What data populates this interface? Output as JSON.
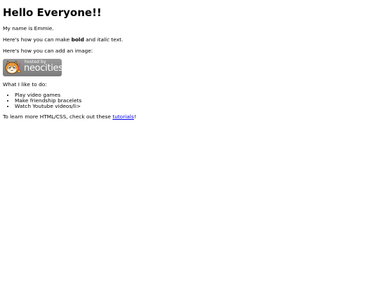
{
  "heading": "Hello Everyone!!",
  "intro": "My name is Emmie.",
  "format_text": {
    "before": "Here's how you can make ",
    "bold": "bold",
    "middle": " and ",
    "italic": "italic",
    "after": " text."
  },
  "image_intro": "Here's how you can add an image:",
  "badge": {
    "hosted": "hosted by",
    "brand": "neocities",
    "colors": {
      "background": "#8a8a8a",
      "cat_orange": "#f2a23a"
    }
  },
  "likes_heading": "What I like to do:",
  "likes": [
    "Play video games",
    "Make friendship bracelets",
    "Watch Youtube videos/li>"
  ],
  "learn_more": {
    "before": "To learn more HTML/CSS, check out these ",
    "link": "tutorials",
    "after": "!"
  }
}
